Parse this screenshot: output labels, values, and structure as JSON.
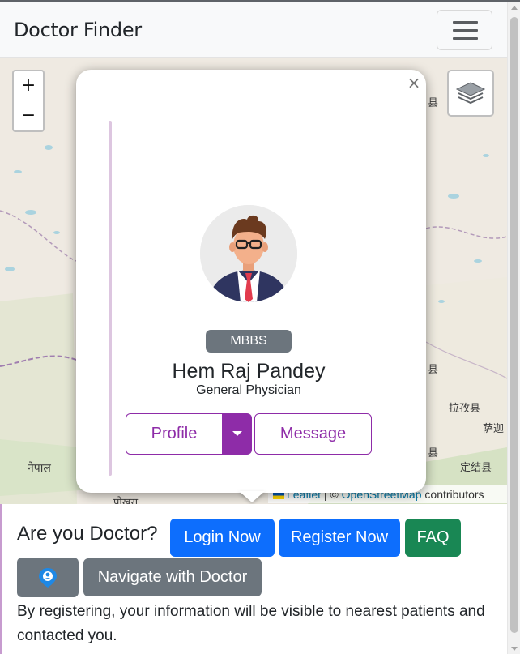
{
  "navbar": {
    "brand": "Doctor Finder",
    "menu_icon": "hamburger-menu-icon"
  },
  "map": {
    "zoom_in_label": "+",
    "zoom_out_label": "−",
    "layers_icon": "layers-icon",
    "labels": [
      "县",
      "县",
      "拉孜县",
      "萨迦",
      "县",
      "定结县",
      "नेपाल",
      "पोखरा"
    ],
    "attribution": {
      "leaflet": "Leaflet",
      "separator": " | © ",
      "osm": "OpenStreetMap",
      "suffix": " contributors"
    }
  },
  "popup": {
    "close_label": "×",
    "doctor": {
      "degree": "MBBS",
      "name": "Hem Raj Pandey",
      "specialty": "General Physician",
      "avatar_icon": "doctor-avatar-icon"
    },
    "profile_label": "Profile",
    "caret_icon": "caret-down-icon",
    "message_label": "Message"
  },
  "panel": {
    "question": "Are you Doctor?",
    "login_label": "Login Now",
    "register_label": "Register Now",
    "faq_label": "FAQ",
    "location_icon": "location-pin-icon",
    "navigate_label": "Navigate with Doctor",
    "notice": "By registering, your information will be visible to nearest patients and contacted you."
  },
  "colors": {
    "primary": "#0d6efd",
    "success": "#198754",
    "secondary": "#6c757d",
    "accent_purple": "#8e2ca8"
  }
}
